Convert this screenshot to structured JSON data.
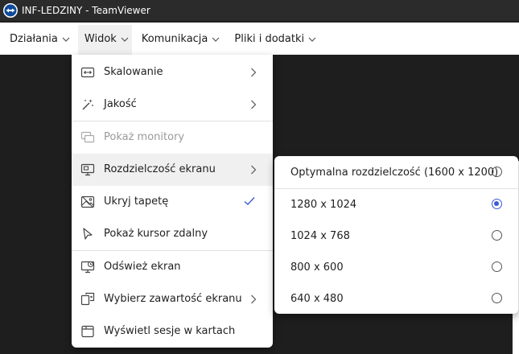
{
  "window": {
    "title": "INF-LEDZINY - TeamViewer"
  },
  "menubar": {
    "items": [
      {
        "label": "Działania"
      },
      {
        "label": "Widok"
      },
      {
        "label": "Komunikacja"
      },
      {
        "label": "Pliki i dodatki"
      }
    ],
    "active": "Widok"
  },
  "view_menu": {
    "items": [
      {
        "label": "Skalowanie",
        "icon": "scaling-icon",
        "submenu": true
      },
      {
        "label": "Jakość",
        "icon": "magic-wand-icon",
        "submenu": true
      },
      {
        "label": "Pokaż monitory",
        "icon": "monitors-icon",
        "disabled": true
      },
      {
        "label": "Rozdzielczość ekranu",
        "icon": "resolution-icon",
        "submenu": true,
        "highlighted": true
      },
      {
        "label": "Ukryj tapetę",
        "icon": "wallpaper-icon",
        "checked": true
      },
      {
        "label": "Pokaż kursor zdalny",
        "icon": "cursor-icon"
      },
      {
        "label": "Odśwież ekran",
        "icon": "refresh-screen-icon"
      },
      {
        "label": "Wybierz zawartość ekranu",
        "icon": "select-content-icon",
        "submenu": true
      },
      {
        "label": "Wyświetl sesje w kartach",
        "icon": "tabs-icon"
      }
    ]
  },
  "resolution_submenu": {
    "items": [
      {
        "label": "Optymalna rozdzielczość (1600 x 1200)",
        "selected": false
      },
      {
        "label": "1280 x 1024",
        "selected": true
      },
      {
        "label": "1024 x 768",
        "selected": false
      },
      {
        "label": "800 x 600",
        "selected": false
      },
      {
        "label": "640 x 480",
        "selected": false
      }
    ]
  },
  "colors": {
    "accent": "#3b5bd6",
    "titlebar": "#2b2b2b",
    "remote_bg": "#1e1e1e"
  }
}
